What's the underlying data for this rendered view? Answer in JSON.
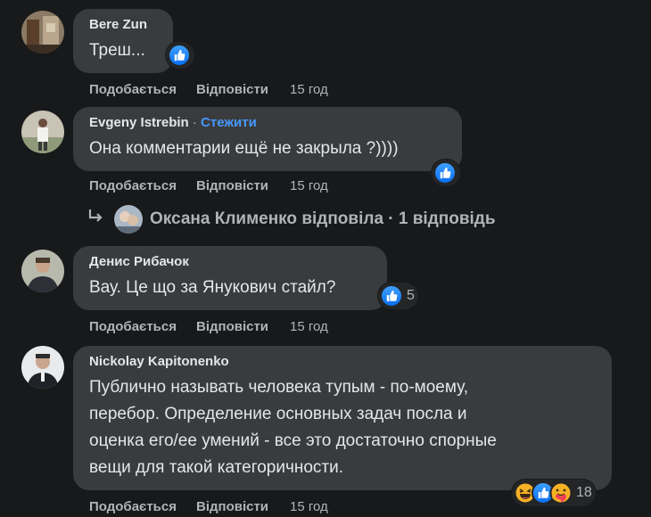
{
  "comments": [
    {
      "author": "Bere Zun",
      "text": "Треш...",
      "like_label": "Подобається",
      "reply_label": "Відповісти",
      "time": "15 год"
    },
    {
      "author": "Evgeny Istrebin",
      "follow_label": "Стежити",
      "separator": "·",
      "text": "Она комментарии ещё не закрыла ?))))",
      "like_label": "Подобається",
      "reply_label": "Відповісти",
      "time": "15 год",
      "replies_summary": "Оксана Клименко відповіла · 1 відповідь"
    },
    {
      "author": "Денис Рибачок",
      "text": "Вау. Це що за Янукович стайл?",
      "reaction_count": "5",
      "like_label": "Подобається",
      "reply_label": "Відповісти",
      "time": "15 год"
    },
    {
      "author": "Nickolay Kapitonenko",
      "text_lines": [
        "Публично называть человека тупым - по-моему,",
        "перебор. Определение основных задач посла и",
        "оценка его/ее умений - все это достаточно спорные",
        "вещи для такой категоричности."
      ],
      "reaction_count": "18",
      "like_label": "Подобається",
      "reply_label": "Відповісти",
      "time": "15 год"
    }
  ],
  "icons": {
    "like": "thumbs-up-icon",
    "haha": "haha-emoji-icon",
    "care": "care-emoji-icon",
    "reply_arrow": "reply-arrow-icon"
  },
  "colors": {
    "background": "#18191a",
    "bubble": "#3a3b3c",
    "link_blue": "#4599ff",
    "muted_text": "#b0b3b8",
    "like_blue": "#0a6ff0"
  }
}
